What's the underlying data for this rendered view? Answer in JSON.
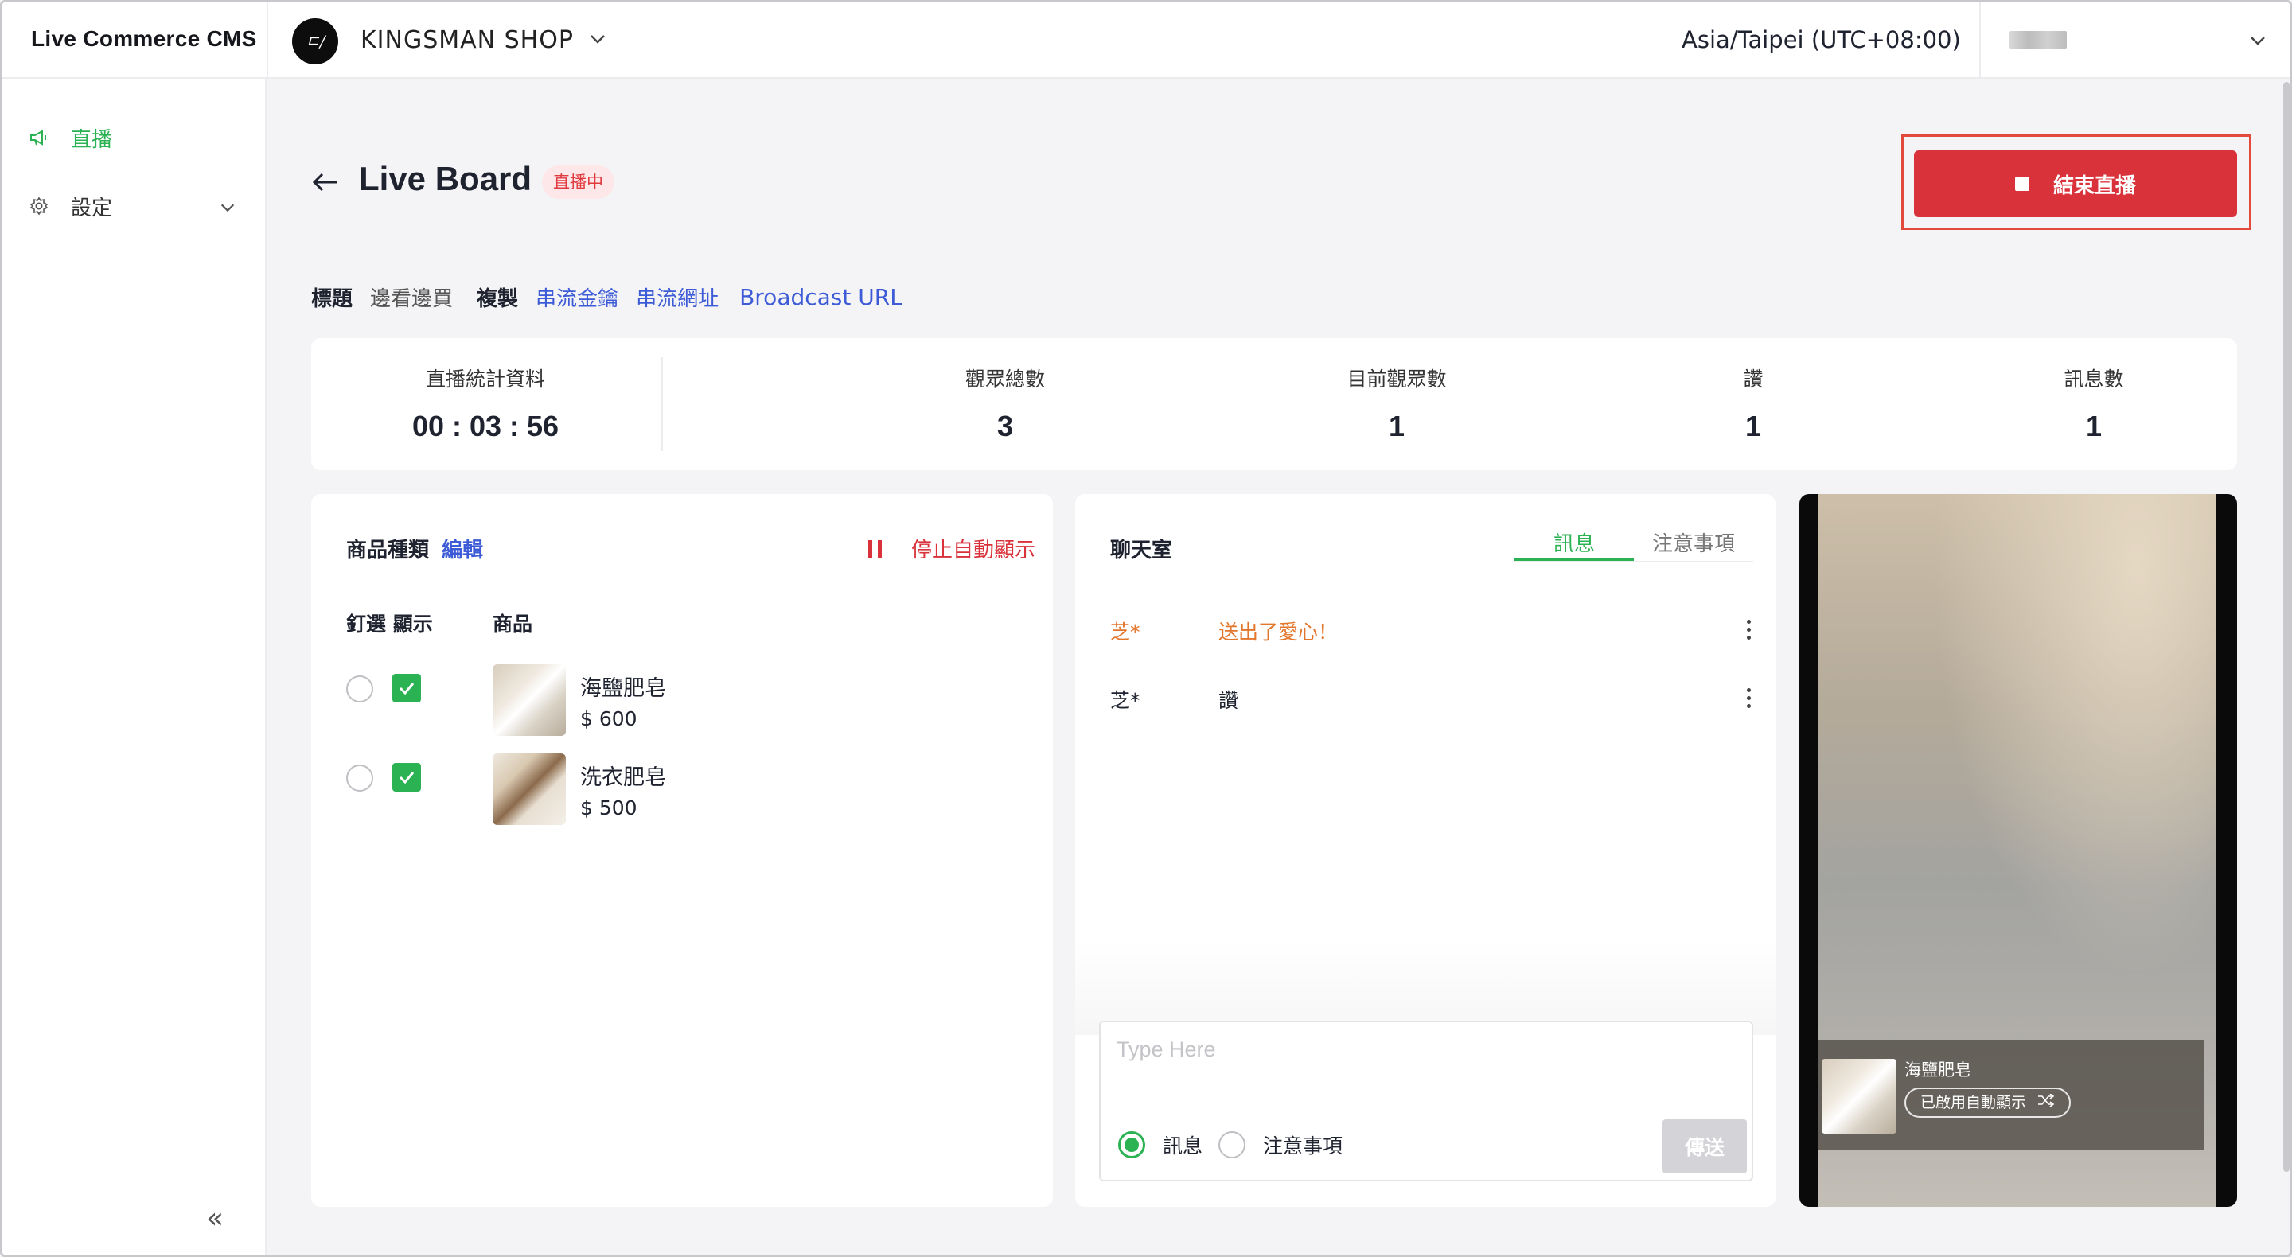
{
  "header": {
    "brand": "Live Commerce CMS",
    "shop_logo_text": "ㄷ/",
    "shop_name": "KINGSMAN SHOP",
    "timezone": "Asia/Taipei (UTC+08:00)"
  },
  "sidebar": {
    "items": [
      {
        "label": "直播",
        "icon": "megaphone-icon",
        "active": true
      },
      {
        "label": "設定",
        "icon": "gear-icon",
        "active": false
      }
    ],
    "collapse_glyph": "«"
  },
  "page": {
    "title": "Live Board",
    "status_badge": "直播中",
    "end_button": "結束直播"
  },
  "meta": {
    "title_label": "標題",
    "title_value": "邊看邊買",
    "copy_label": "複製",
    "links": [
      "串流金鑰",
      "串流網址",
      "Broadcast URL"
    ]
  },
  "stats": [
    {
      "label": "直播統計資料",
      "value": "00 : 03 : 56"
    },
    {
      "label": "觀眾總數",
      "value": "3"
    },
    {
      "label": "目前觀眾數",
      "value": "1"
    },
    {
      "label": "讚",
      "value": "1"
    },
    {
      "label": "訊息數",
      "value": "1"
    }
  ],
  "products_card": {
    "heading": "商品種類",
    "edit": "編輯",
    "stop_auto": "停止自動顯示",
    "col_pin_show": "釘選 顯示",
    "col_product": "商品",
    "items": [
      {
        "name": "海鹽肥皂",
        "price": "$ 600",
        "pinned": false,
        "shown": true
      },
      {
        "name": "洗衣肥皂",
        "price": "$ 500",
        "pinned": false,
        "shown": true
      }
    ]
  },
  "chat": {
    "heading": "聊天室",
    "tabs": [
      "訊息",
      "注意事項"
    ],
    "active_tab": "訊息",
    "messages": [
      {
        "user": "芝*",
        "text": "送出了愛心！",
        "highlight": true
      },
      {
        "user": "芝*",
        "text": "讚",
        "highlight": false
      }
    ],
    "input_placeholder": "Type Here",
    "input_value": "",
    "type_options": [
      "訊息",
      "注意事項"
    ],
    "selected_type": "訊息",
    "send": "傳送"
  },
  "preview": {
    "product_name": "海鹽肥皂",
    "auto_display_label": "已啟用自動顯示"
  },
  "colors": {
    "accent_green": "#2bb253",
    "danger_red": "#d9323a",
    "link_blue": "#3d5bd6",
    "highlight_orange": "#e2762c"
  }
}
